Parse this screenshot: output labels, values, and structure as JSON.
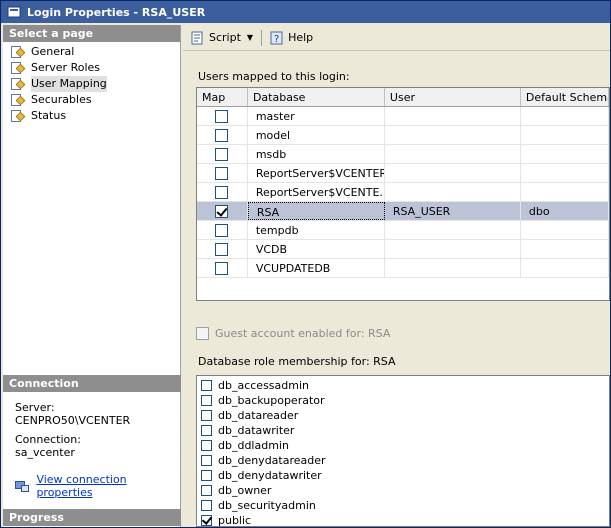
{
  "window": {
    "title": "Login Properties - RSA_USER"
  },
  "left": {
    "select_header": "Select a page",
    "pages": [
      "General",
      "Server Roles",
      "User Mapping",
      "Securables",
      "Status"
    ],
    "selected_index": 2,
    "connection_header": "Connection",
    "server_label": "Server:",
    "server_value": "CENPRO50\\VCENTER",
    "connection_label": "Connection:",
    "connection_value": "sa_vcenter",
    "view_link": "View connection properties",
    "progress_header": "Progress"
  },
  "toolbar": {
    "script_label": "Script",
    "help_label": "Help"
  },
  "users": {
    "label": "Users mapped to this login:",
    "columns": [
      "Map",
      "Database",
      "User",
      "Default Schema"
    ],
    "rows": [
      {
        "checked": false,
        "database": "master",
        "user": "",
        "schema": ""
      },
      {
        "checked": false,
        "database": "model",
        "user": "",
        "schema": ""
      },
      {
        "checked": false,
        "database": "msdb",
        "user": "",
        "schema": ""
      },
      {
        "checked": false,
        "database": "ReportServer$VCENTER",
        "user": "",
        "schema": ""
      },
      {
        "checked": false,
        "database": "ReportServer$VCENTE...",
        "user": "",
        "schema": ""
      },
      {
        "checked": true,
        "database": "RSA",
        "user": "RSA_USER",
        "schema": "dbo"
      },
      {
        "checked": false,
        "database": "tempdb",
        "user": "",
        "schema": ""
      },
      {
        "checked": false,
        "database": "VCDB",
        "user": "",
        "schema": ""
      },
      {
        "checked": false,
        "database": "VCUPDATEDB",
        "user": "",
        "schema": ""
      }
    ],
    "selected_index": 5
  },
  "guest": {
    "label": "Guest account enabled for: RSA",
    "checked": false
  },
  "roles": {
    "label": "Database role membership for: RSA",
    "items": [
      {
        "name": "db_accessadmin",
        "checked": false
      },
      {
        "name": "db_backupoperator",
        "checked": false
      },
      {
        "name": "db_datareader",
        "checked": false
      },
      {
        "name": "db_datawriter",
        "checked": false
      },
      {
        "name": "db_ddladmin",
        "checked": false
      },
      {
        "name": "db_denydatareader",
        "checked": false
      },
      {
        "name": "db_denydatawriter",
        "checked": false
      },
      {
        "name": "db_owner",
        "checked": false
      },
      {
        "name": "db_securityadmin",
        "checked": false
      },
      {
        "name": "public",
        "checked": true
      }
    ]
  },
  "colors": {
    "title_bar": "#3a5f9c",
    "section_header": "#8e8e8e",
    "selected_row": "#bdc3d6",
    "link": "#0033cc"
  },
  "icons": {
    "script": "script-icon",
    "help": "help-icon",
    "page": "page-icon",
    "connection": "connection-properties-icon"
  }
}
